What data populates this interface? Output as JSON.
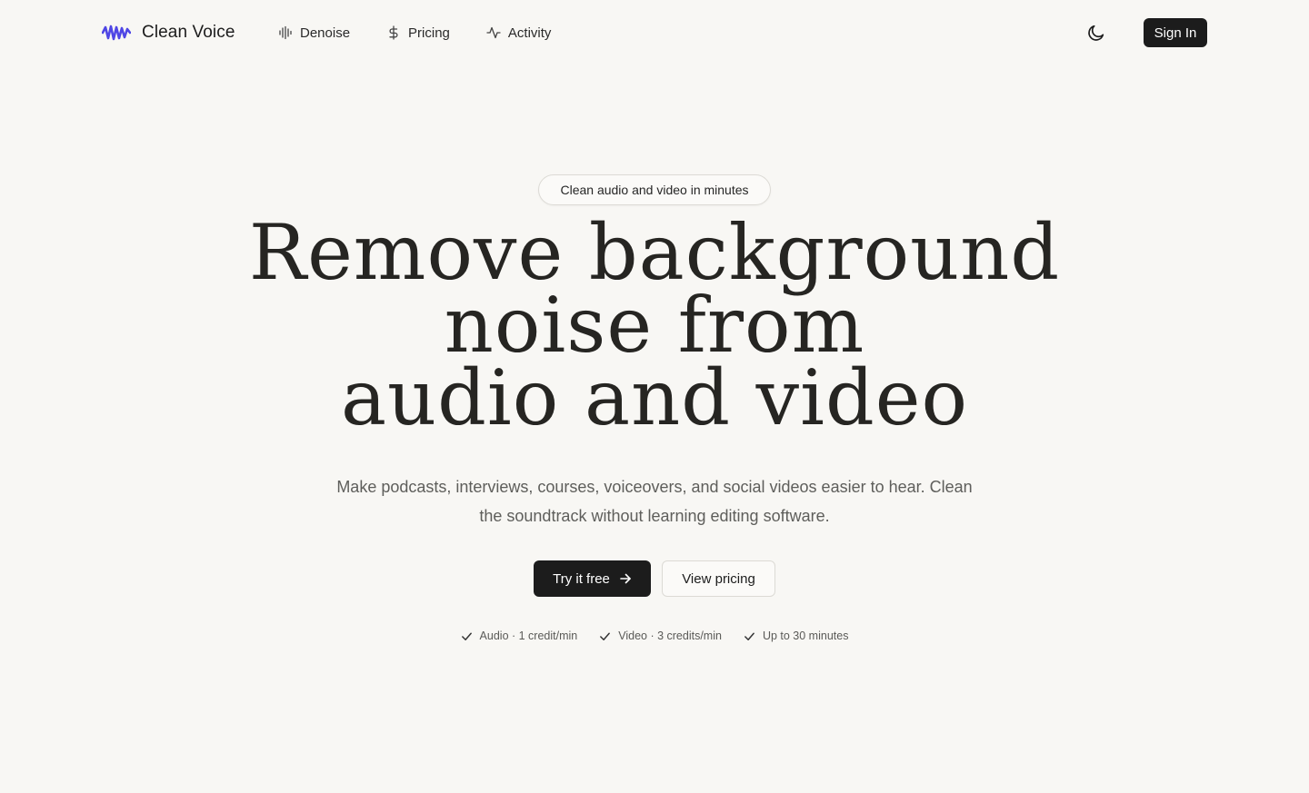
{
  "brand": {
    "name": "Clean Voice",
    "accent": "#4f46e5"
  },
  "nav": {
    "items": [
      {
        "label": "Denoise",
        "icon": "audio-lines-icon"
      },
      {
        "label": "Pricing",
        "icon": "dollar-sign-icon"
      },
      {
        "label": "Activity",
        "icon": "activity-icon"
      }
    ],
    "theme_icon": "moon-icon",
    "signin_label": "Sign In"
  },
  "hero": {
    "badge": "Clean audio and video in minutes",
    "headline_lines": [
      "Remove background",
      "noise from",
      "audio and video"
    ],
    "subtitle": "Make podcasts, interviews, courses, voiceovers, and social videos easier to hear. Clean the soundtrack without learning editing software.",
    "primary_cta": "Try it free",
    "secondary_cta": "View pricing",
    "features": [
      "Audio · 1 credit/min",
      "Video · 3 credits/min",
      "Up to 30 minutes"
    ]
  },
  "colors": {
    "background": "#f8f7f4",
    "text": "#1c1c1c",
    "muted": "#5e5e5b",
    "button_dark": "#1c1c1c"
  }
}
